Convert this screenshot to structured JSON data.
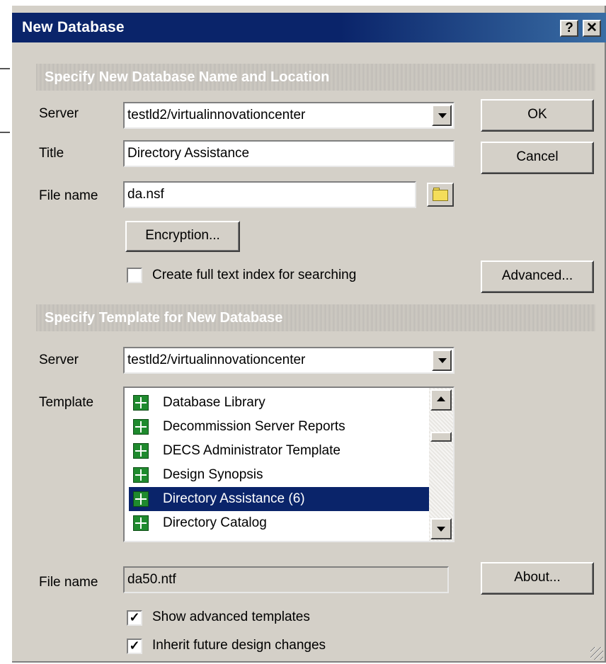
{
  "window": {
    "title": "New Database",
    "help_label": "?",
    "close_label": "✕"
  },
  "section_new": {
    "header": "Specify New Database Name and Location",
    "server_label": "Server",
    "server_value": "testld2/virtualinnovationcenter",
    "title_label": "Title",
    "title_value": "Directory Assistance",
    "filename_label": "File name",
    "filename_value": "da.nsf",
    "folder_icon": "folder-icon",
    "encryption_button": "Encryption...",
    "fulltext_checkbox": {
      "label": "Create full text index for searching",
      "checked": false
    }
  },
  "buttons": {
    "ok": "OK",
    "cancel": "Cancel",
    "advanced": "Advanced...",
    "about": "About..."
  },
  "section_template": {
    "header": "Specify Template for New Database",
    "server_label": "Server",
    "server_value": "testld2/virtualinnovationcenter",
    "template_label": "Template",
    "templates": [
      {
        "label": "Database Library",
        "selected": false
      },
      {
        "label": "Decommission Server Reports",
        "selected": false
      },
      {
        "label": "DECS Administrator Template",
        "selected": false
      },
      {
        "label": "Design Synopsis",
        "selected": false
      },
      {
        "label": "Directory Assistance (6)",
        "selected": true
      },
      {
        "label": "Directory Catalog",
        "selected": false
      }
    ],
    "filename_label": "File name",
    "filename_value": "da50.ntf",
    "show_advanced": {
      "label": "Show advanced templates",
      "checked": true
    },
    "inherit_design": {
      "label": "Inherit future design changes",
      "checked": true
    }
  },
  "colors": {
    "title_bar": "#0a246a",
    "dialog_face": "#d4d0c8",
    "selection": "#0a246a",
    "template_icon": "#1f8a2e"
  }
}
